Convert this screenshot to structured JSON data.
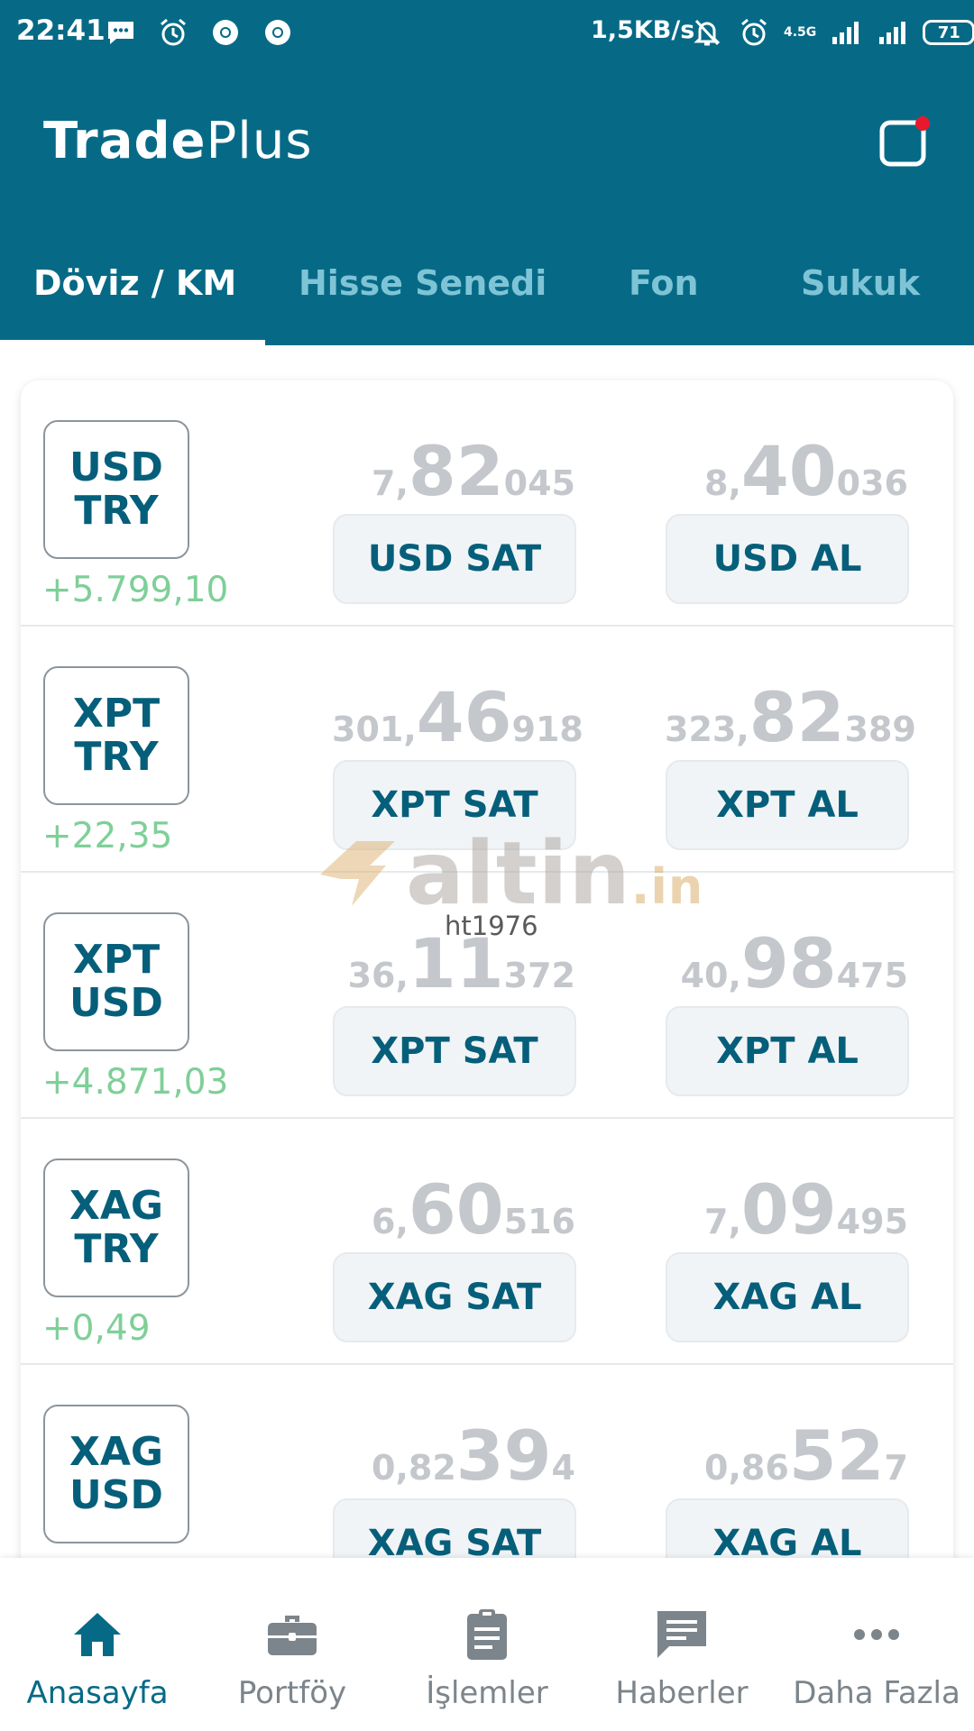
{
  "status_bar": {
    "time": "22:41",
    "speed": "1,5KB/s",
    "network": "4.5G",
    "battery": "71",
    "icons_left": [
      "message-icon",
      "alarm-icon",
      "chrome-icon",
      "chrome-icon"
    ],
    "icons_right": [
      "bell-off-icon",
      "alarm-icon",
      "signal-icon",
      "signal-icon",
      "battery-icon"
    ]
  },
  "app": {
    "title_bold": "Trade",
    "title_light": "Plus",
    "notification_icon": "notification-icon",
    "brand_color": "#066a86",
    "notification_dot_color": "#e8192c"
  },
  "tabs": [
    {
      "label": "Döviz / KM",
      "active": true
    },
    {
      "label": "Hisse Senedi",
      "active": false
    },
    {
      "label": "Fon",
      "active": false
    },
    {
      "label": "Sukuk",
      "active": false
    }
  ],
  "rows": [
    {
      "base": "USD",
      "quote": "TRY",
      "change": "+5.799,10",
      "sell": {
        "pre": "7,",
        "mid": "82",
        "post": "045"
      },
      "buy": {
        "pre": "8,",
        "mid": "40",
        "post": "036"
      },
      "sell_label": "USD SAT",
      "buy_label": "USD AL"
    },
    {
      "base": "XPT",
      "quote": "TRY",
      "change": "+22,35",
      "sell": {
        "pre": "301,",
        "mid": "46",
        "post": "918"
      },
      "buy": {
        "pre": "323,",
        "mid": "82",
        "post": "389"
      },
      "sell_label": "XPT SAT",
      "buy_label": "XPT AL"
    },
    {
      "base": "XPT",
      "quote": "USD",
      "change": "+4.871,03",
      "sell": {
        "pre": "36,",
        "mid": "11",
        "post": "372"
      },
      "buy": {
        "pre": "40,",
        "mid": "98",
        "post": "475"
      },
      "sell_label": "XPT SAT",
      "buy_label": "XPT AL"
    },
    {
      "base": "XAG",
      "quote": "TRY",
      "change": "+0,49",
      "sell": {
        "pre": "6,",
        "mid": "60",
        "post": "516"
      },
      "buy": {
        "pre": "7,",
        "mid": "09",
        "post": "495"
      },
      "sell_label": "XAG SAT",
      "buy_label": "XAG AL"
    },
    {
      "base": "XAG",
      "quote": "USD",
      "change": "",
      "sell": {
        "pre": "0,82",
        "mid": "39",
        "post": "4"
      },
      "buy": {
        "pre": "0,86",
        "mid": "52",
        "post": "7"
      },
      "sell_label": "XAG SAT",
      "buy_label": "XAG AL"
    }
  ],
  "watermark": {
    "brand": "altin",
    "tld": ".in",
    "user": "ht1976"
  },
  "bottom_nav": [
    {
      "label": "Anasayfa",
      "icon": "home-icon",
      "active": true
    },
    {
      "label": "Portföy",
      "icon": "briefcase-icon",
      "active": false
    },
    {
      "label": "İşlemler",
      "icon": "clipboard-icon",
      "active": false
    },
    {
      "label": "Haberler",
      "icon": "chat-icon",
      "active": false
    },
    {
      "label": "Daha Fazla",
      "icon": "more-icon",
      "active": false
    }
  ]
}
